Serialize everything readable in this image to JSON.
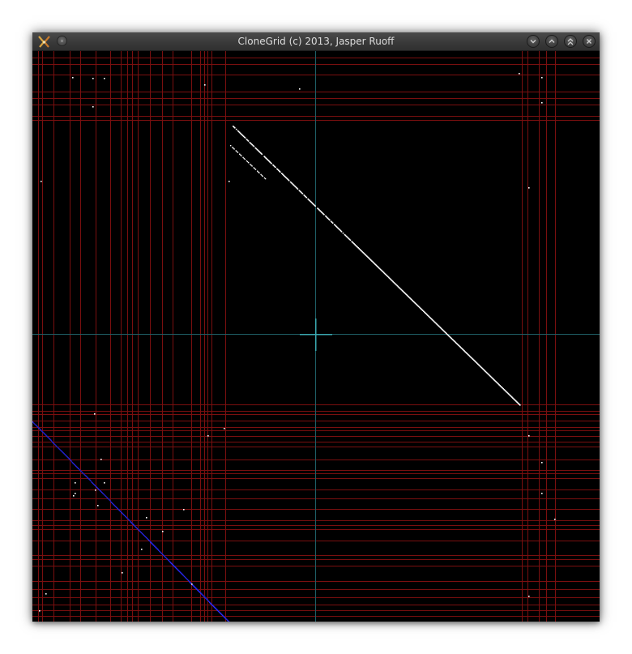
{
  "window": {
    "title": "CloneGrid (c) 2013, Jasper Ruoff",
    "app_icon": "clonegrid-app-icon",
    "menu_icon": "window-menu-icon",
    "controls": [
      {
        "name": "minimize-button",
        "icon": "chevron-down-icon"
      },
      {
        "name": "maximize-button",
        "icon": "chevron-up-icon"
      },
      {
        "name": "keep-above-button",
        "icon": "double-chevron-up-icon"
      },
      {
        "name": "close-button",
        "icon": "close-icon"
      }
    ]
  },
  "colors": {
    "background": "#000000",
    "grid_lines": "#7a0f0f",
    "crosshair": "#1f5f66",
    "crosshair_center": "#3aa8b0",
    "clone_dots_main": "#ffffff",
    "clone_dots_secondary": "#2b2bff"
  }
}
